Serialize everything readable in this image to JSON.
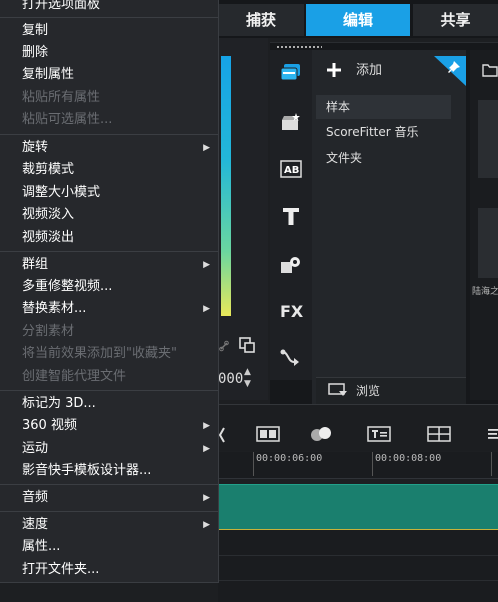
{
  "tabs": {
    "capture": "捕获",
    "edit": "编辑",
    "share": "共享"
  },
  "player": {
    "timecode_fragment": "000"
  },
  "library": {
    "add_label": "添加",
    "items": [
      "样本",
      "ScoreFitter 音乐",
      "文件夹"
    ],
    "browse_label": "浏览",
    "thumb_caption": "陆海之"
  },
  "timeline": {
    "ruler_labels": [
      "00:00:06:00",
      "00:00:08:00"
    ]
  },
  "context_menu": {
    "top_item": "打开选项面板",
    "items": [
      {
        "label": "复制",
        "enabled": true,
        "submenu": false
      },
      {
        "label": "删除",
        "enabled": true,
        "submenu": false
      },
      {
        "label": "复制属性",
        "enabled": true,
        "submenu": false
      },
      {
        "label": "粘贴所有属性",
        "enabled": false,
        "submenu": false
      },
      {
        "label": "粘贴可选属性...",
        "enabled": false,
        "submenu": false
      },
      {
        "label": "旋转",
        "enabled": true,
        "submenu": true
      },
      {
        "label": "裁剪模式",
        "enabled": true,
        "submenu": false
      },
      {
        "label": "调整大小模式",
        "enabled": true,
        "submenu": false
      },
      {
        "label": "视频淡入",
        "enabled": true,
        "submenu": false
      },
      {
        "label": "视频淡出",
        "enabled": true,
        "submenu": false
      },
      {
        "label": "群组",
        "enabled": true,
        "submenu": true
      },
      {
        "label": "多重修整视频...",
        "enabled": true,
        "submenu": false
      },
      {
        "label": "替换素材...",
        "enabled": true,
        "submenu": true
      },
      {
        "label": "分割素材",
        "enabled": false,
        "submenu": false
      },
      {
        "label": "将当前效果添加到\"收藏夹\"",
        "enabled": false,
        "submenu": false
      },
      {
        "label": "创建智能代理文件",
        "enabled": false,
        "submenu": false
      },
      {
        "label": "标记为 3D...",
        "enabled": true,
        "submenu": false
      },
      {
        "label": "360 视频",
        "enabled": true,
        "submenu": true
      },
      {
        "label": "运动",
        "enabled": true,
        "submenu": true
      },
      {
        "label": "影音快手模板设计器...",
        "enabled": true,
        "submenu": false
      },
      {
        "label": "音频",
        "enabled": true,
        "submenu": true
      },
      {
        "label": "速度",
        "enabled": true,
        "submenu": true
      },
      {
        "label": "属性...",
        "enabled": true,
        "submenu": false
      },
      {
        "label": "打开文件夹...",
        "enabled": true,
        "submenu": false
      }
    ]
  }
}
